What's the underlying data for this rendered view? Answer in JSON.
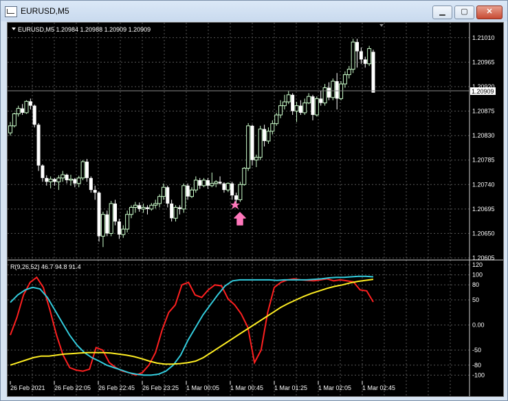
{
  "window": {
    "title": "EURUSD,M5",
    "buttons": {
      "minimize": "▁",
      "maximize": "▢",
      "close": "✕"
    }
  },
  "main_chart": {
    "header": "EURUSD,M5  1.20984 1.20988 1.20909 1.20909",
    "price_labels": [
      "1.21010",
      "1.20965",
      "1.20920",
      "1.20875",
      "1.20830",
      "1.20785",
      "1.20740",
      "1.20695",
      "1.20650",
      "1.20605"
    ],
    "current_price": "1.20909",
    "background": "#000000",
    "bull_color": "#ccffcc",
    "bear_color": "#ffffff"
  },
  "indicator": {
    "header": "R(9,26,52) 46.7 94.8 91.4",
    "levels": [
      "120",
      "100",
      "80",
      "50",
      "0.00",
      "-50",
      "-80",
      "-100"
    ],
    "line_colors": {
      "fast": "#ff2020",
      "mid": "#33ccdd",
      "slow": "#ffee22"
    }
  },
  "time_labels": [
    "26 Feb 2021",
    "26 Feb 22:05",
    "26 Feb 22:45",
    "26 Feb 23:25",
    "1 Mar 00:05",
    "1 Mar 00:45",
    "1 Mar 01:25",
    "1 Mar 02:05",
    "1 Mar 02:45"
  ],
  "signal": {
    "marker_color": "#ff77bb",
    "icons": [
      "star-icon",
      "arrow-up-icon"
    ]
  },
  "chart_data": {
    "type": "candlestick",
    "symbol": "EURUSD",
    "timeframe": "M5",
    "ylim": [
      1.20605,
      1.2103
    ],
    "candles": [
      [
        1.20835,
        1.20855,
        1.2083,
        1.20848
      ],
      [
        1.20848,
        1.20872,
        1.20845,
        1.2087
      ],
      [
        1.2087,
        1.20885,
        1.20865,
        1.2088
      ],
      [
        1.2088,
        1.20888,
        1.20868,
        1.20872
      ],
      [
        1.20872,
        1.20895,
        1.2087,
        1.20893
      ],
      [
        1.20893,
        1.20898,
        1.20878,
        1.20885
      ],
      [
        1.20885,
        1.20887,
        1.20845,
        1.2085
      ],
      [
        1.2085,
        1.20853,
        1.20765,
        1.20775
      ],
      [
        1.20775,
        1.20777,
        1.20745,
        1.20752
      ],
      [
        1.20752,
        1.20757,
        1.20738,
        1.20745
      ],
      [
        1.20745,
        1.20755,
        1.20733,
        1.2075
      ],
      [
        1.2075,
        1.20752,
        1.20738,
        1.20745
      ],
      [
        1.20745,
        1.20757,
        1.2073,
        1.20752
      ],
      [
        1.20752,
        1.20765,
        1.20745,
        1.20758
      ],
      [
        1.20758,
        1.2076,
        1.20742,
        1.20748
      ],
      [
        1.20748,
        1.20758,
        1.20738,
        1.2075
      ],
      [
        1.2075,
        1.20752,
        1.20735,
        1.20742
      ],
      [
        1.20742,
        1.20756,
        1.20735,
        1.20752
      ],
      [
        1.20752,
        1.20785,
        1.20748,
        1.20782
      ],
      [
        1.20782,
        1.20787,
        1.20745,
        1.20752
      ],
      [
        1.20752,
        1.20755,
        1.20725,
        1.2073
      ],
      [
        1.2073,
        1.20738,
        1.20712,
        1.20725
      ],
      [
        1.20725,
        1.20727,
        1.20635,
        1.20645
      ],
      [
        1.20645,
        1.2069,
        1.20625,
        1.20685
      ],
      [
        1.20685,
        1.20692,
        1.20645,
        1.2065
      ],
      [
        1.2065,
        1.2071,
        1.20645,
        1.20705
      ],
      [
        1.20705,
        1.20712,
        1.20665,
        1.20672
      ],
      [
        1.20672,
        1.20677,
        1.2064,
        1.20648
      ],
      [
        1.20648,
        1.20665,
        1.20642,
        1.20658
      ],
      [
        1.20658,
        1.20692,
        1.20652,
        1.20685
      ],
      [
        1.20685,
        1.20702,
        1.20678,
        1.20698
      ],
      [
        1.20698,
        1.20708,
        1.20688,
        1.20702
      ],
      [
        1.20702,
        1.20707,
        1.2069,
        1.20695
      ],
      [
        1.20695,
        1.20705,
        1.20688,
        1.20698
      ],
      [
        1.20698,
        1.20702,
        1.20685,
        1.20695
      ],
      [
        1.20695,
        1.20706,
        1.20692,
        1.20702
      ],
      [
        1.20702,
        1.20712,
        1.20696,
        1.20705
      ],
      [
        1.20705,
        1.20722,
        1.20698,
        1.20718
      ],
      [
        1.20718,
        1.20742,
        1.20712,
        1.20735
      ],
      [
        1.20735,
        1.20738,
        1.20698,
        1.20705
      ],
      [
        1.20705,
        1.20712,
        1.20672,
        1.20678
      ],
      [
        1.20678,
        1.20702,
        1.20672,
        1.20698
      ],
      [
        1.20698,
        1.20702,
        1.20685,
        1.20695
      ],
      [
        1.20695,
        1.20742,
        1.20688,
        1.20738
      ],
      [
        1.20738,
        1.20742,
        1.20712,
        1.20718
      ],
      [
        1.20718,
        1.20735,
        1.20715,
        1.2073
      ],
      [
        1.2073,
        1.20755,
        1.20725,
        1.20748
      ],
      [
        1.20748,
        1.20752,
        1.20732,
        1.20738
      ],
      [
        1.20738,
        1.20752,
        1.20735,
        1.20748
      ],
      [
        1.20748,
        1.20752,
        1.20732,
        1.20738
      ],
      [
        1.20738,
        1.20762,
        1.20735,
        1.20742
      ],
      [
        1.20742,
        1.20748,
        1.20735,
        1.20745
      ],
      [
        1.20745,
        1.20755,
        1.2074,
        1.20742
      ],
      [
        1.20742,
        1.20744,
        1.20725,
        1.2073
      ],
      [
        1.2073,
        1.20744,
        1.20726,
        1.20742
      ],
      [
        1.20742,
        1.20745,
        1.20712,
        1.2072
      ],
      [
        1.2072,
        1.20725,
        1.20705,
        1.20712
      ],
      [
        1.20712,
        1.20745,
        1.20708,
        1.2074
      ],
      [
        1.2074,
        1.20772,
        1.20738,
        1.2077
      ],
      [
        1.2077,
        1.20853,
        1.20765,
        1.20848
      ],
      [
        1.20848,
        1.2085,
        1.20775,
        1.20785
      ],
      [
        1.20785,
        1.20795,
        1.20772,
        1.2079
      ],
      [
        1.2079,
        1.20848,
        1.20785,
        1.20842
      ],
      [
        1.20842,
        1.2085,
        1.2081,
        1.2082
      ],
      [
        1.2082,
        1.20845,
        1.20815,
        1.20838
      ],
      [
        1.20838,
        1.20858,
        1.20832,
        1.20852
      ],
      [
        1.20852,
        1.20872,
        1.20848,
        1.20868
      ],
      [
        1.20868,
        1.20895,
        1.20862,
        1.20885
      ],
      [
        1.20885,
        1.20905,
        1.20878,
        1.20892
      ],
      [
        1.20892,
        1.20912,
        1.20888,
        1.20905
      ],
      [
        1.20905,
        1.20908,
        1.20868,
        1.20875
      ],
      [
        1.20875,
        1.20892,
        1.20855,
        1.20885
      ],
      [
        1.20885,
        1.20895,
        1.20868,
        1.20872
      ],
      [
        1.20872,
        1.20898,
        1.20868,
        1.2089
      ],
      [
        1.2089,
        1.20908,
        1.20888,
        1.20902
      ],
      [
        1.20902,
        1.20905,
        1.20858,
        1.20868
      ],
      [
        1.20868,
        1.20902,
        1.20865,
        1.20898
      ],
      [
        1.20898,
        1.20912,
        1.20885,
        1.2089
      ],
      [
        1.2089,
        1.20925,
        1.20885,
        1.20918
      ],
      [
        1.20918,
        1.20928,
        1.20895,
        1.209
      ],
      [
        1.209,
        1.20935,
        1.20895,
        1.2093
      ],
      [
        1.2093,
        1.20945,
        1.20878,
        1.20898
      ],
      [
        1.20898,
        1.2093,
        1.20895,
        1.20925
      ],
      [
        1.20925,
        1.20948,
        1.20918,
        1.20942
      ],
      [
        1.20942,
        1.20958,
        1.20935,
        1.20952
      ],
      [
        1.20952,
        1.21008,
        1.20945,
        1.21002
      ],
      [
        1.21002,
        1.21008,
        1.20955,
        1.20985
      ],
      [
        1.20985,
        1.20992,
        1.20962,
        1.2097
      ],
      [
        1.2097,
        1.20975,
        1.20955,
        1.20962
      ],
      [
        1.20962,
        1.20995,
        1.20958,
        1.2099
      ],
      [
        1.20984,
        1.20988,
        1.20909,
        1.20909
      ]
    ],
    "indicator_series": [
      {
        "name": "fast",
        "values": [
          -20,
          15,
          60,
          85,
          95,
          75,
          30,
          -20,
          -60,
          -85,
          -90,
          -92,
          -88,
          -45,
          -50,
          -75,
          -85,
          -92,
          -95,
          -100,
          -95,
          -80,
          -55,
          -10,
          25,
          40,
          80,
          85,
          60,
          55,
          70,
          80,
          78,
          52,
          40,
          22,
          -5,
          -75,
          -50,
          25,
          75,
          85,
          90,
          92,
          90,
          89,
          88,
          90,
          92,
          88,
          90,
          88,
          86,
          70,
          68,
          46
        ]
      },
      {
        "name": "mid",
        "values": [
          45,
          60,
          70,
          75,
          72,
          55,
          30,
          5,
          -20,
          -40,
          -55,
          -65,
          -72,
          -80,
          -85,
          -90,
          -95,
          -98,
          -100,
          -100,
          -98,
          -92,
          -80,
          -60,
          -30,
          -5,
          20,
          40,
          60,
          78,
          88,
          90,
          90,
          90,
          90,
          90,
          89,
          90,
          90,
          90,
          90,
          91,
          92,
          94,
          95,
          95,
          96,
          97,
          97,
          96
        ]
      },
      {
        "name": "slow",
        "values": [
          -80,
          -75,
          -70,
          -65,
          -62,
          -62,
          -60,
          -58,
          -57,
          -56,
          -55,
          -55,
          -55,
          -56,
          -58,
          -60,
          -63,
          -67,
          -72,
          -76,
          -78,
          -78,
          -77,
          -75,
          -72,
          -65,
          -55,
          -45,
          -35,
          -25,
          -15,
          -5,
          5,
          15,
          25,
          35,
          43,
          50,
          57,
          63,
          68,
          73,
          77,
          80,
          84,
          87,
          89,
          91
        ]
      }
    ]
  }
}
